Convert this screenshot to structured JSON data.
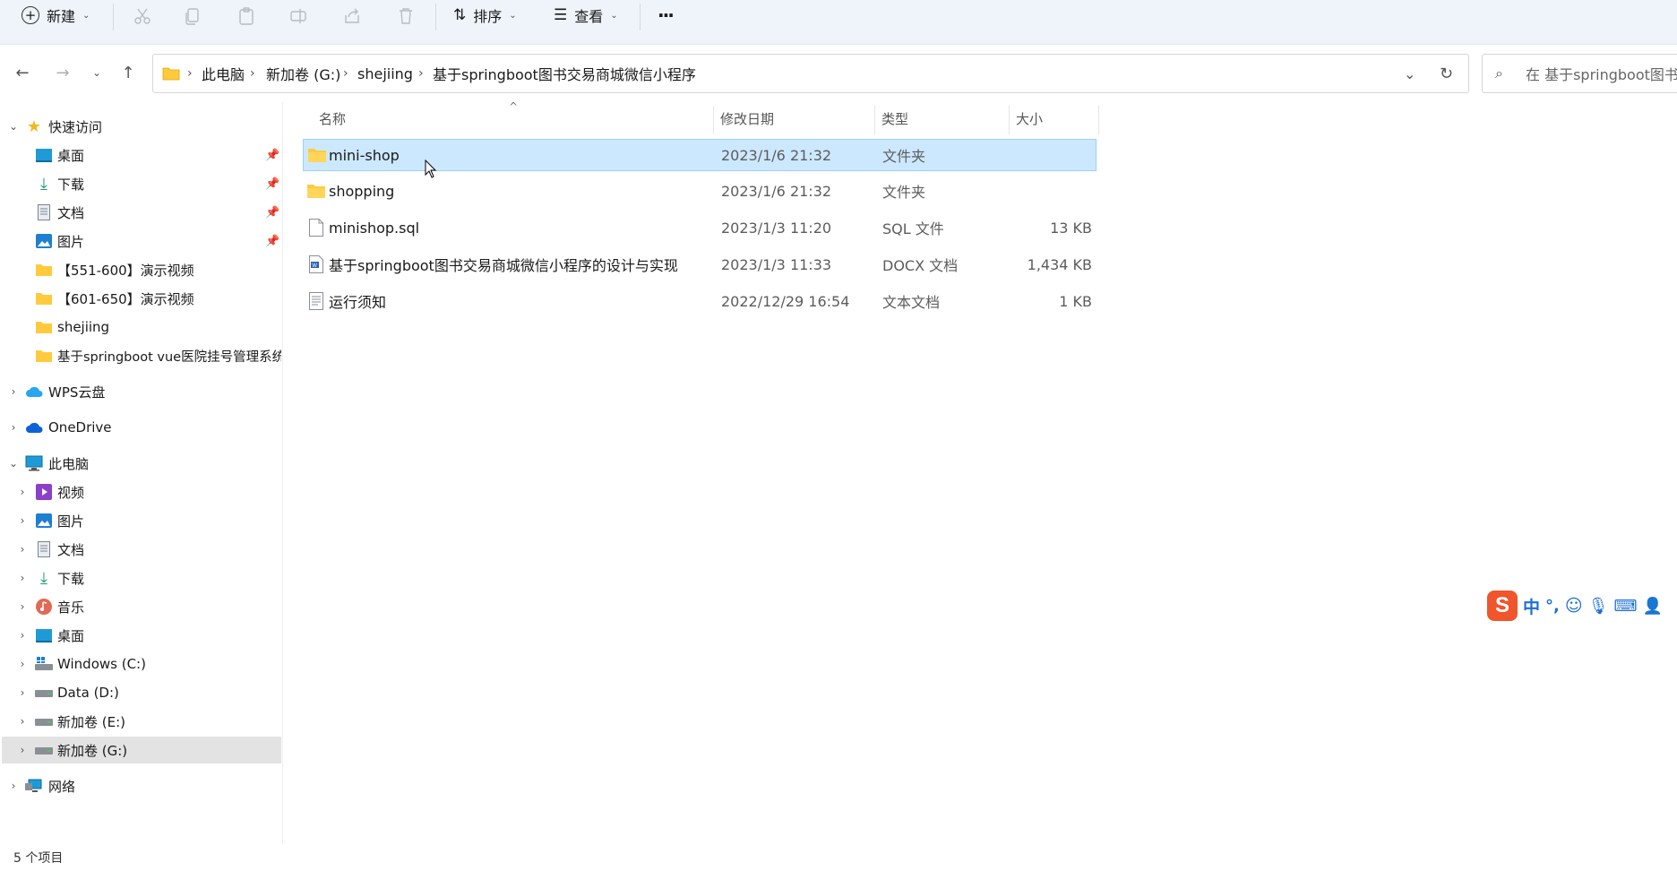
{
  "toolbar": {
    "new_label": "新建",
    "sort_label": "排序",
    "view_label": "查看",
    "more_label": "···"
  },
  "address": {
    "crumbs": [
      "此电脑",
      "新加卷 (G:)",
      "shejiing",
      "基于springboot图书交易商城微信小程序"
    ],
    "search_placeholder": "在 基于springboot图书交"
  },
  "sidebar": {
    "quick_access_label": "快速访问",
    "quick_items": [
      "桌面",
      "下载",
      "文档",
      "图片",
      "【551-600】演示视频",
      "【601-650】演示视频",
      "shejiing",
      "基于springboot vue医院挂号管理系统"
    ],
    "wps_label": "WPS云盘",
    "onedrive_label": "OneDrive",
    "thispc_label": "此电脑",
    "pc_items": [
      "视频",
      "图片",
      "文档",
      "下载",
      "音乐",
      "桌面",
      "Windows (C:)",
      "Data (D:)",
      "新加卷 (E:)",
      "新加卷 (G:)"
    ],
    "network_label": "网络"
  },
  "columns": {
    "name": "名称",
    "date": "修改日期",
    "type": "类型",
    "size": "大小"
  },
  "files": [
    {
      "name": "mini-shop",
      "date": "2023/1/6 21:32",
      "type": "文件夹",
      "size": "",
      "icon": "folder-icon"
    },
    {
      "name": "shopping",
      "date": "2023/1/6 21:32",
      "type": "文件夹",
      "size": "",
      "icon": "folder-icon"
    },
    {
      "name": "minishop.sql",
      "date": "2023/1/3 11:20",
      "type": "SQL 文件",
      "size": "13 KB",
      "icon": "file-icon"
    },
    {
      "name": "基于springboot图书交易商城微信小程序的设计与实现",
      "date": "2023/1/3 11:33",
      "type": "DOCX 文档",
      "size": "1,434 KB",
      "icon": "docx-icon"
    },
    {
      "name": "运行须知",
      "date": "2022/12/29 16:54",
      "type": "文本文档",
      "size": "1 KB",
      "icon": "text-file-icon"
    }
  ],
  "status": {
    "count": "5 个项目"
  },
  "ime": {
    "logo": "S",
    "mode": "中"
  },
  "colors": {
    "selected_bg": "#cce8ff",
    "selected_border": "#99d1ff",
    "folder": "#ffcb3d",
    "ime_brand": "#f0552b"
  }
}
